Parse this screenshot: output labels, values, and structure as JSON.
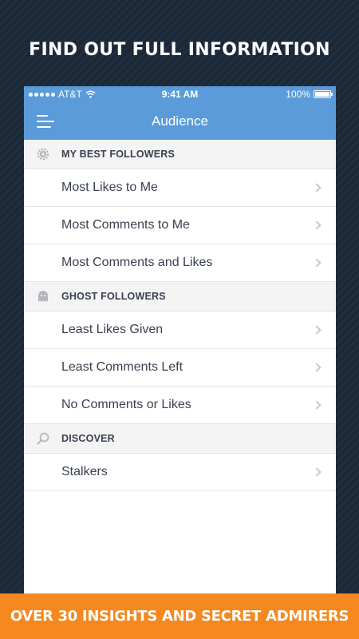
{
  "headline": "FIND OUT FULL INFORMATION",
  "status_bar": {
    "carrier": "AT&T",
    "time": "9:41 AM",
    "battery": "100%",
    "battery_level": 1.0
  },
  "nav": {
    "title": "Audience",
    "menu_icon": "hamburger-menu-icon"
  },
  "sections": [
    {
      "title": "MY BEST FOLLOWERS",
      "icon": "gear-icon",
      "items": [
        {
          "label": "Most Likes to Me"
        },
        {
          "label": "Most Comments to Me"
        },
        {
          "label": "Most Comments and Likes"
        }
      ]
    },
    {
      "title": "GHOST FOLLOWERS",
      "icon": "ghost-icon",
      "items": [
        {
          "label": "Least Likes Given"
        },
        {
          "label": "Least Comments Left"
        },
        {
          "label": "No Comments or Likes"
        }
      ]
    },
    {
      "title": "DISCOVER",
      "icon": "search-icon",
      "items": [
        {
          "label": "Stalkers"
        }
      ]
    }
  ],
  "banner": "OVER 30 INSIGHTS AND SECRET ADMIRERS",
  "colors": {
    "background": "#1b2838",
    "nav_blue": "#5b9bd9",
    "banner_orange": "#f5881f",
    "section_bg": "#f4f4f5",
    "text": "#3a4150"
  }
}
